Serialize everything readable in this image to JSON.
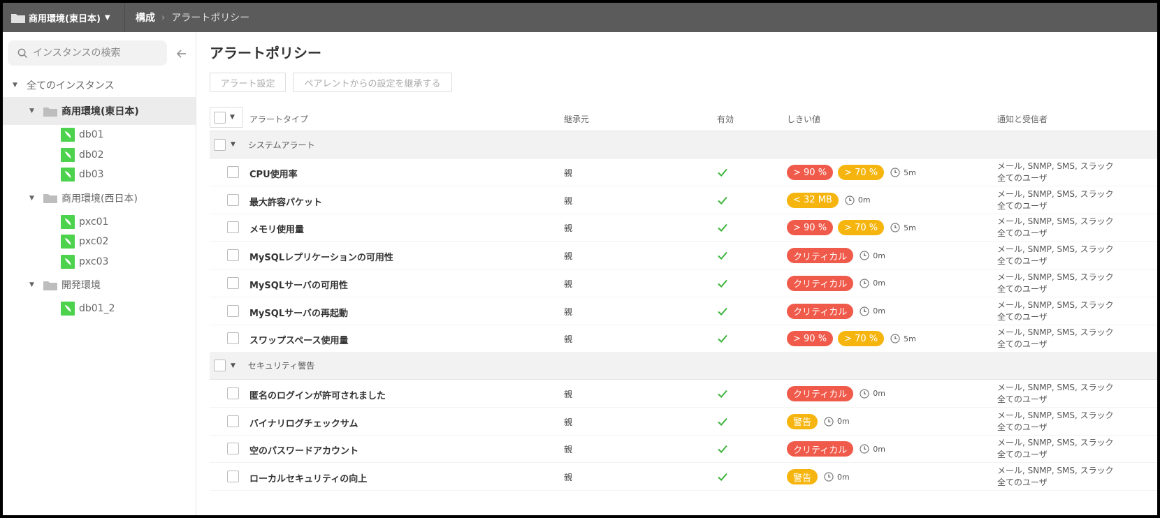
{
  "topbar": {
    "environment": "商用環境(東日本)",
    "breadcrumb": [
      "構成",
      "アラートポリシー"
    ]
  },
  "sidebar": {
    "search_placeholder": "インスタンスの検索",
    "root": "全てのインスタンス",
    "groups": [
      {
        "name": "商用環境(東日本)",
        "selected": true,
        "instances": [
          "db01",
          "db02",
          "db03"
        ]
      },
      {
        "name": "商用環境(西日本)",
        "selected": false,
        "instances": [
          "pxc01",
          "pxc02",
          "pxc03"
        ]
      },
      {
        "name": "開発環境",
        "selected": false,
        "instances": [
          "db01_2"
        ]
      }
    ]
  },
  "main": {
    "title": "アラートポリシー",
    "buttons": {
      "alert_settings": "アラート設定",
      "inherit": "ペアレントからの設定を継承する"
    },
    "columns": {
      "type": "アラートタイプ",
      "inherited": "継承元",
      "enabled": "有効",
      "threshold": "しきい値",
      "notify": "通知と受信者"
    },
    "sections": [
      {
        "name": "システムアラート",
        "rows": [
          {
            "name": "CPU使用率",
            "inherited": "親",
            "badges": [
              {
                "text": "> 90 %",
                "color": "#f05a4a"
              },
              {
                "text": "> 70 %",
                "color": "#f6b50e"
              }
            ],
            "duration": "5m",
            "notify": "メール, SNMP, SMS, スラック",
            "recipients": "全てのユーザ"
          },
          {
            "name": "最大許容パケット",
            "inherited": "親",
            "badges": [
              {
                "text": "< 32 MB",
                "color": "#f6b50e"
              }
            ],
            "duration": "0m",
            "notify": "メール, SNMP, SMS, スラック",
            "recipients": "全てのユーザ"
          },
          {
            "name": "メモリ使用量",
            "inherited": "親",
            "badges": [
              {
                "text": "> 90 %",
                "color": "#f05a4a"
              },
              {
                "text": "> 70 %",
                "color": "#f6b50e"
              }
            ],
            "duration": "5m",
            "notify": "メール, SNMP, SMS, スラック",
            "recipients": "全てのユーザ"
          },
          {
            "name": "MySQLレプリケーションの可用性",
            "inherited": "親",
            "badges": [
              {
                "text": "クリティカル",
                "color": "#f05a4a"
              }
            ],
            "duration": "0m",
            "notify": "メール, SNMP, SMS, スラック",
            "recipients": "全てのユーザ"
          },
          {
            "name": "MySQLサーバの可用性",
            "inherited": "親",
            "badges": [
              {
                "text": "クリティカル",
                "color": "#f05a4a"
              }
            ],
            "duration": "0m",
            "notify": "メール, SNMP, SMS, スラック",
            "recipients": "全てのユーザ"
          },
          {
            "name": "MySQLサーバの再起動",
            "inherited": "親",
            "badges": [
              {
                "text": "クリティカル",
                "color": "#f05a4a"
              }
            ],
            "duration": "0m",
            "notify": "メール, SNMP, SMS, スラック",
            "recipients": "全てのユーザ"
          },
          {
            "name": "スワップスペース使用量",
            "inherited": "親",
            "badges": [
              {
                "text": "> 90 %",
                "color": "#f05a4a"
              },
              {
                "text": "> 70 %",
                "color": "#f6b50e"
              }
            ],
            "duration": "5m",
            "notify": "メール, SNMP, SMS, スラック",
            "recipients": "全てのユーザ"
          }
        ]
      },
      {
        "name": "セキュリティ警告",
        "rows": [
          {
            "name": "匿名のログインが許可されました",
            "inherited": "親",
            "badges": [
              {
                "text": "クリティカル",
                "color": "#f05a4a"
              }
            ],
            "duration": "0m",
            "notify": "メール, SNMP, SMS, スラック",
            "recipients": "全てのユーザ"
          },
          {
            "name": "バイナリログチェックサム",
            "inherited": "親",
            "badges": [
              {
                "text": "警告",
                "color": "#f6b50e"
              }
            ],
            "duration": "0m",
            "notify": "メール, SNMP, SMS, スラック",
            "recipients": "全てのユーザ"
          },
          {
            "name": "空のパスワードアカウント",
            "inherited": "親",
            "badges": [
              {
                "text": "クリティカル",
                "color": "#f05a4a"
              }
            ],
            "duration": "0m",
            "notify": "メール, SNMP, SMS, スラック",
            "recipients": "全てのユーザ"
          },
          {
            "name": "ローカルセキュリティの向上",
            "inherited": "親",
            "badges": [
              {
                "text": "警告",
                "color": "#f6b50e"
              }
            ],
            "duration": "0m",
            "notify": "メール, SNMP, SMS, スラック",
            "recipients": "全てのユーザ"
          }
        ]
      }
    ]
  }
}
